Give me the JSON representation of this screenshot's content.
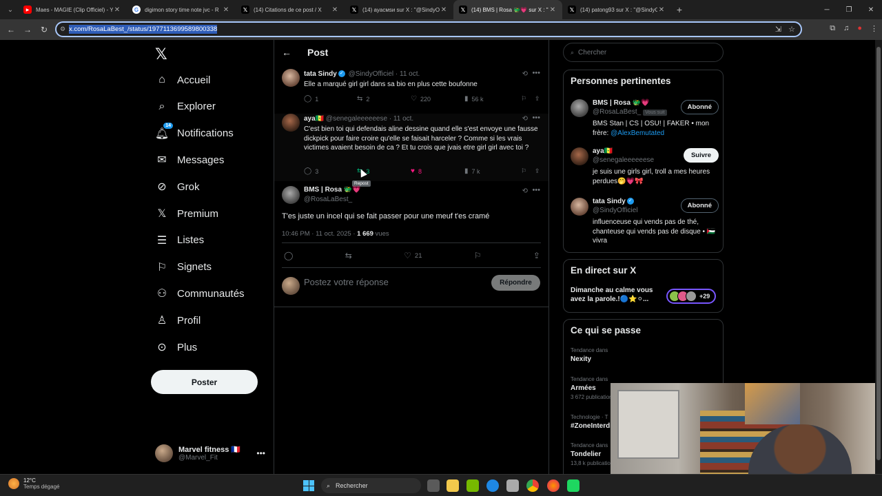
{
  "browser": {
    "tabs": [
      {
        "title": "Maes - MAGIE (Clip Officiel) - Y",
        "favicon": "youtube-icon",
        "color": "#ff0000",
        "active": false
      },
      {
        "title": "digimon story time note jvc - R",
        "favicon": "google-icon",
        "color": "#ffffff",
        "active": false
      },
      {
        "title": "(14) Citations de ce post / X",
        "favicon": "x-icon",
        "color": "#000000",
        "active": false
      },
      {
        "title": "(14) ayacмsи sur X : \"@SindyOf",
        "favicon": "x-icon",
        "color": "#000000",
        "active": false
      },
      {
        "title": "(14) BMS | Rosa 🐲💗 sur X : \"",
        "favicon": "x-icon",
        "color": "#000000",
        "active": true
      },
      {
        "title": "(14) patong93 sur X : \"@SindyO",
        "favicon": "x-icon",
        "color": "#000000",
        "active": false
      }
    ],
    "url": "x.com/RosaLaBest_/status/1977113699589800338"
  },
  "nav": {
    "items": [
      {
        "label": "Accueil",
        "icon": "home-icon",
        "glyph": "⌂"
      },
      {
        "label": "Explorer",
        "icon": "search-icon",
        "glyph": "⌕"
      },
      {
        "label": "Notifications",
        "icon": "bell-icon",
        "glyph": "🔔︎",
        "badge": "14"
      },
      {
        "label": "Messages",
        "icon": "mail-icon",
        "glyph": "✉"
      },
      {
        "label": "Grok",
        "icon": "grok-icon",
        "glyph": "⊘"
      },
      {
        "label": "Premium",
        "icon": "x-premium-icon",
        "glyph": "𝕏"
      },
      {
        "label": "Listes",
        "icon": "list-icon",
        "glyph": "☰"
      },
      {
        "label": "Signets",
        "icon": "bookmark-icon",
        "glyph": "⚐"
      },
      {
        "label": "Communautés",
        "icon": "communities-icon",
        "glyph": "⚇"
      },
      {
        "label": "Profil",
        "icon": "profile-icon",
        "glyph": "♙"
      },
      {
        "label": "Plus",
        "icon": "more-circle-icon",
        "glyph": "⊙"
      }
    ],
    "post_button": "Poster",
    "account": {
      "name": "Marvel fitness 🇫🇷",
      "handle": "@Marvel_Fit"
    }
  },
  "thread": {
    "header_title": "Post",
    "tweets": [
      {
        "name": "tata Sindy",
        "handle": "@SindyOfficiel",
        "date": "· 11 oct.",
        "text": "Elle a marqué girl girl dans sa bio en plus cette boufonne",
        "replies": "1",
        "reposts": "2",
        "likes": "220",
        "views": "56 k"
      },
      {
        "name": "aya🇸🇳",
        "handle": "@senegaleeeeeese",
        "date": "· 11 oct.",
        "text": "C'est bien toi qui defendais aline dessine quand elle s'est envoye une fausse dickpick pour faire croire qu'elle se faisait harceler ? Comme si les vrais victimes avaient besoin de ca ? Et tu crois que jvais etre girl girl avec toi ?",
        "replies": "3",
        "reposts": "3",
        "likes": "8",
        "views": "7 k",
        "tooltip": "Repost"
      }
    ],
    "main": {
      "name": "BMS | Rosa 🐲💗",
      "handle": "@RosaLaBest_",
      "text": "T'es juste un incel qui se fait passer pour une meuf t'es cramé",
      "time": "10:46 PM · 11 oct. 2025 · ",
      "views_count": "1 669",
      "views_label": " vues",
      "likes": "21"
    },
    "reply_placeholder": "Postez votre réponse",
    "reply_button": "Répondre"
  },
  "sidebar": {
    "search_placeholder": "Chercher",
    "relevant_title": "Personnes pertinentes",
    "people": [
      {
        "name": "BMS | Rosa 🐲💗",
        "handle": "@RosaLaBest_",
        "follows_you": "Vous suit",
        "bio_text": "BMS Stan | CS | OSU! | FAKER • mon frère: ",
        "bio_link": "@AlexBemutated",
        "button": "Abonné"
      },
      {
        "name": "aya🇸🇳",
        "handle": "@senegaleeeeeese",
        "bio_text": "je suis une girls girl, troll a mes heures perdues🤭💗🎀",
        "button": "Suivre"
      },
      {
        "name": "tata Sindy",
        "handle": "@SindyOfficiel",
        "bio_text": "influenceuse qui vends pas de thé, chanteuse qui vends pas de disque • 🇵🇸 vivra",
        "button": "Abonné"
      }
    ],
    "live_title": "En direct sur X",
    "live_text": "Dimanche au calme vous avez la parole.!🔵⭐⚪...",
    "live_count": "+29",
    "trends_title": "Ce qui se passe",
    "trends": [
      {
        "context": "Tendance dans",
        "name": "Nexity",
        "count": ""
      },
      {
        "context": "Tendance dans",
        "name": "Armées",
        "count": "3 672 publications"
      },
      {
        "context": "Technologie · T",
        "name": "#ZoneInterdite",
        "count": ""
      },
      {
        "context": "Tendance dans",
        "name": "Tondelier",
        "count": "13,8 k publications"
      }
    ]
  },
  "taskbar": {
    "temperature": "12°C",
    "weather": "Temps dégagé",
    "search": "Rechercher"
  }
}
